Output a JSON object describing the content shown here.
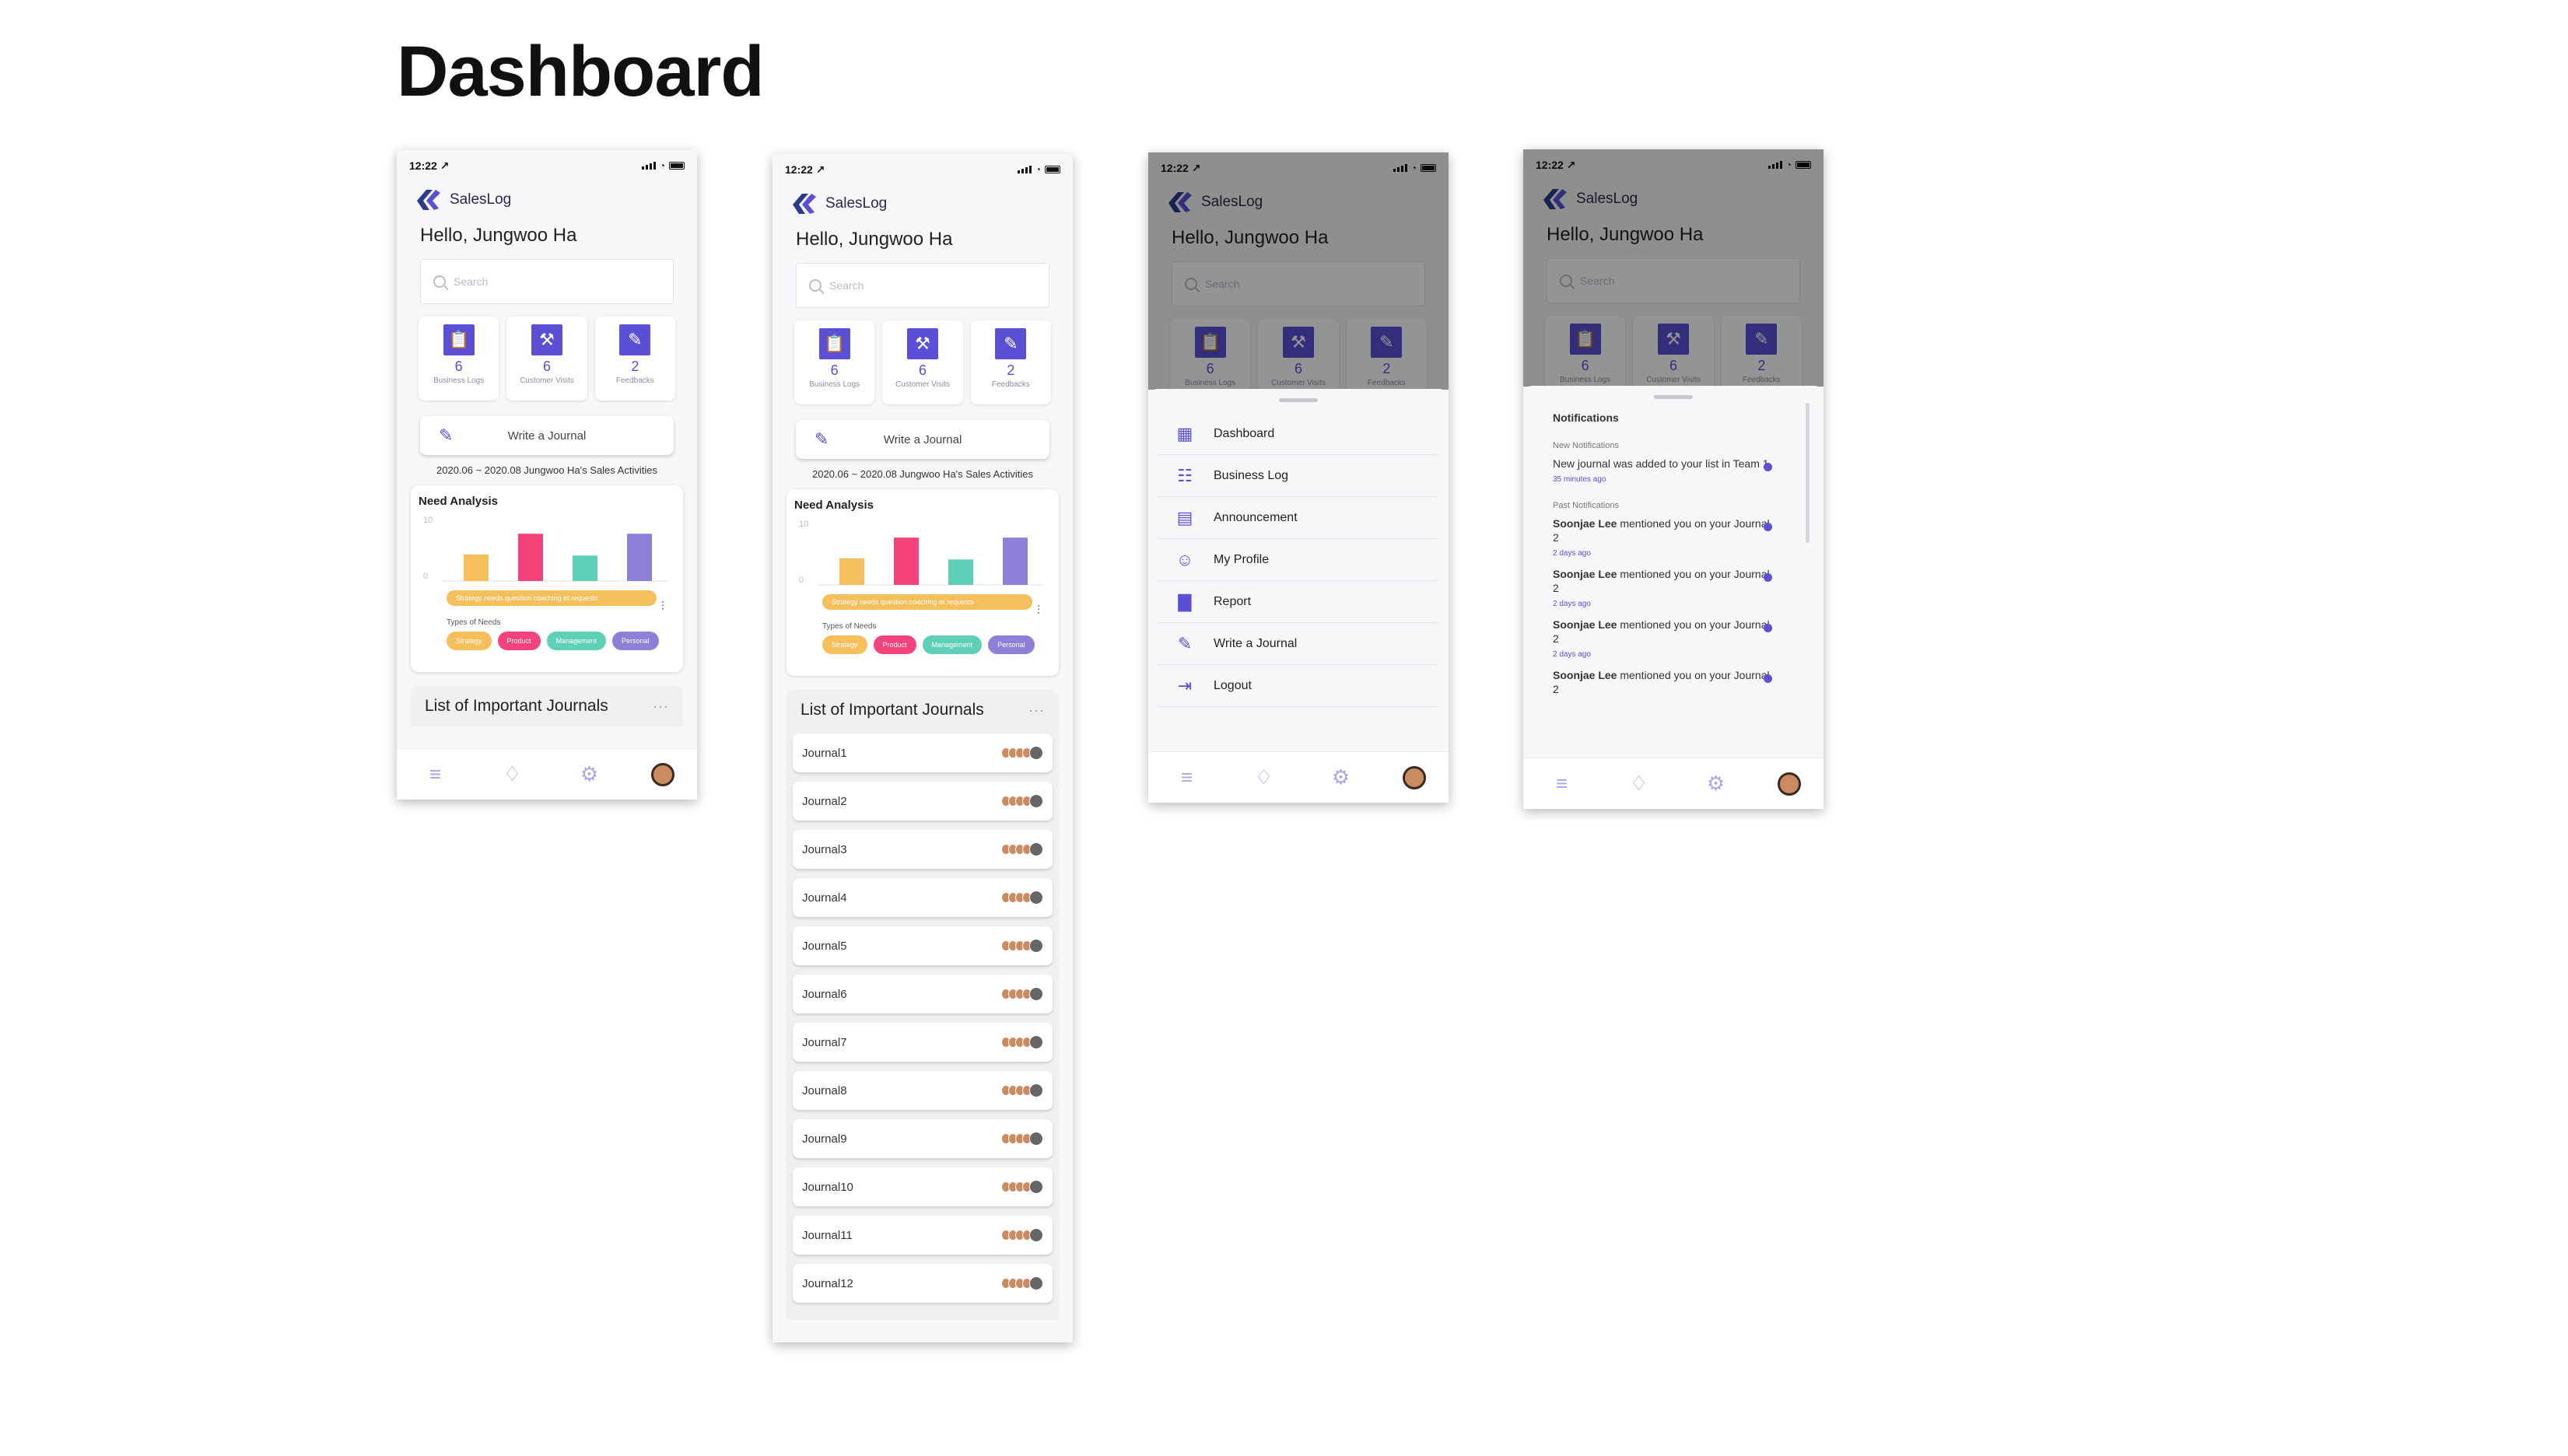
{
  "page": {
    "title": "Dashboard"
  },
  "status": {
    "time": "12:22"
  },
  "app": {
    "name": "SalesLog",
    "greeting": "Hello, Jungwoo Ha"
  },
  "search": {
    "placeholder": "Search"
  },
  "stats": [
    {
      "value": "6",
      "label": "Business Logs",
      "icon": "clipboard-icon"
    },
    {
      "value": "6",
      "label": "Customer Visits",
      "icon": "hammer-icon"
    },
    {
      "value": "2",
      "label": "Feedbacks",
      "icon": "chat-edit-icon"
    }
  ],
  "write": {
    "label": "Write a Journal"
  },
  "period": "2020.06 ~ 2020.08 Jungwoo Ha's Sales Activities",
  "analysis": {
    "title": "Need Analysis",
    "types_label": "Types of Needs",
    "legend_text": "Strategy needs question coaching et requests",
    "chips": [
      {
        "label": "Strategy",
        "color": "#f5c05b"
      },
      {
        "label": "Product",
        "color": "#f2437a"
      },
      {
        "label": "Management",
        "color": "#5fd0b8"
      },
      {
        "label": "Personal",
        "color": "#8f7fd6"
      }
    ]
  },
  "chart_data": {
    "type": "bar",
    "categories": [
      "Strategy",
      "Product",
      "Management",
      "Personal"
    ],
    "values": [
      4.5,
      8,
      4.3,
      8
    ],
    "ylim": [
      0,
      10
    ],
    "yticks": [
      "10",
      "0"
    ],
    "colors": [
      "#f5c05b",
      "#f2437a",
      "#5fd0b8",
      "#8f7fd6"
    ]
  },
  "journals": {
    "title": "List of Important Journals",
    "items": [
      "Journal1",
      "Journal2",
      "Journal3",
      "Journal4",
      "Journal5",
      "Journal6",
      "Journal7",
      "Journal8",
      "Journal9",
      "Journal10",
      "Journal11",
      "Journal12"
    ]
  },
  "menu": {
    "items": [
      {
        "label": "Dashboard",
        "icon": "grid-icon"
      },
      {
        "label": "Business Log",
        "icon": "document-icon"
      },
      {
        "label": "Announcement",
        "icon": "newspaper-icon"
      },
      {
        "label": "My Profile",
        "icon": "person-icon"
      },
      {
        "label": "Report",
        "icon": "bar-chart-icon"
      },
      {
        "label": "Write a Journal",
        "icon": "pencil-icon"
      },
      {
        "label": "Logout",
        "icon": "logout-icon"
      }
    ]
  },
  "notifications": {
    "title": "Notifications",
    "new_label": "New Notifications",
    "past_label": "Past Notifications",
    "new_items": [
      {
        "text": "New journal was added to your list in Team 1",
        "time": "35 minutes ago"
      }
    ],
    "past_items": [
      {
        "name": "Soonjae Lee",
        "text": " mentioned you on your Journal 2",
        "time": "2 days ago"
      },
      {
        "name": "Soonjae Lee",
        "text": " mentioned you on your Journal 2",
        "time": "2 days ago"
      },
      {
        "name": "Soonjae Lee",
        "text": " mentioned you on your Journal 2",
        "time": "2 days ago"
      },
      {
        "name": "Soonjae Lee",
        "text": " mentioned you on your Journal 2",
        "time": ""
      }
    ]
  }
}
